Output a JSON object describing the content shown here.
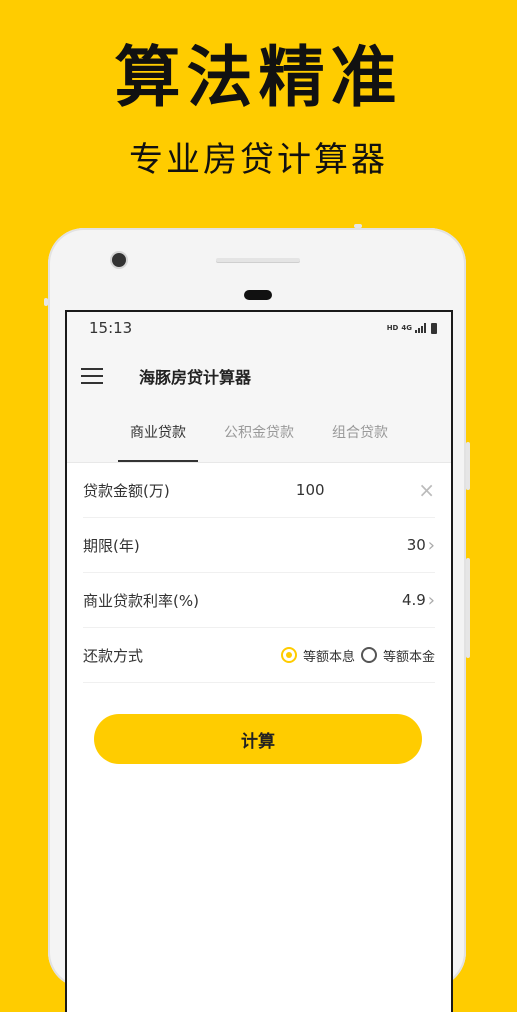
{
  "promo": {
    "headline": "算法精准",
    "subheadline": "专业房贷计算器"
  },
  "status_bar": {
    "time": "15:13",
    "hd": "HD",
    "network": "4G"
  },
  "app_bar": {
    "title": "海豚房贷计算器"
  },
  "tabs": [
    {
      "label": "商业贷款",
      "active": true
    },
    {
      "label": "公积金贷款",
      "active": false
    },
    {
      "label": "组合贷款",
      "active": false
    }
  ],
  "form": {
    "amount": {
      "label": "贷款金额(万)",
      "value": "100"
    },
    "term": {
      "label": "期限(年)",
      "value": "30"
    },
    "rate": {
      "label": "商业贷款利率(%)",
      "value": "4.9"
    },
    "method": {
      "label": "还款方式",
      "options": [
        "等额本息",
        "等额本金"
      ],
      "selected": "等额本息"
    }
  },
  "calculate_button": {
    "label": "计算"
  },
  "colors": {
    "accent": "#FFCC00",
    "text": "#333333",
    "muted": "#999999"
  }
}
